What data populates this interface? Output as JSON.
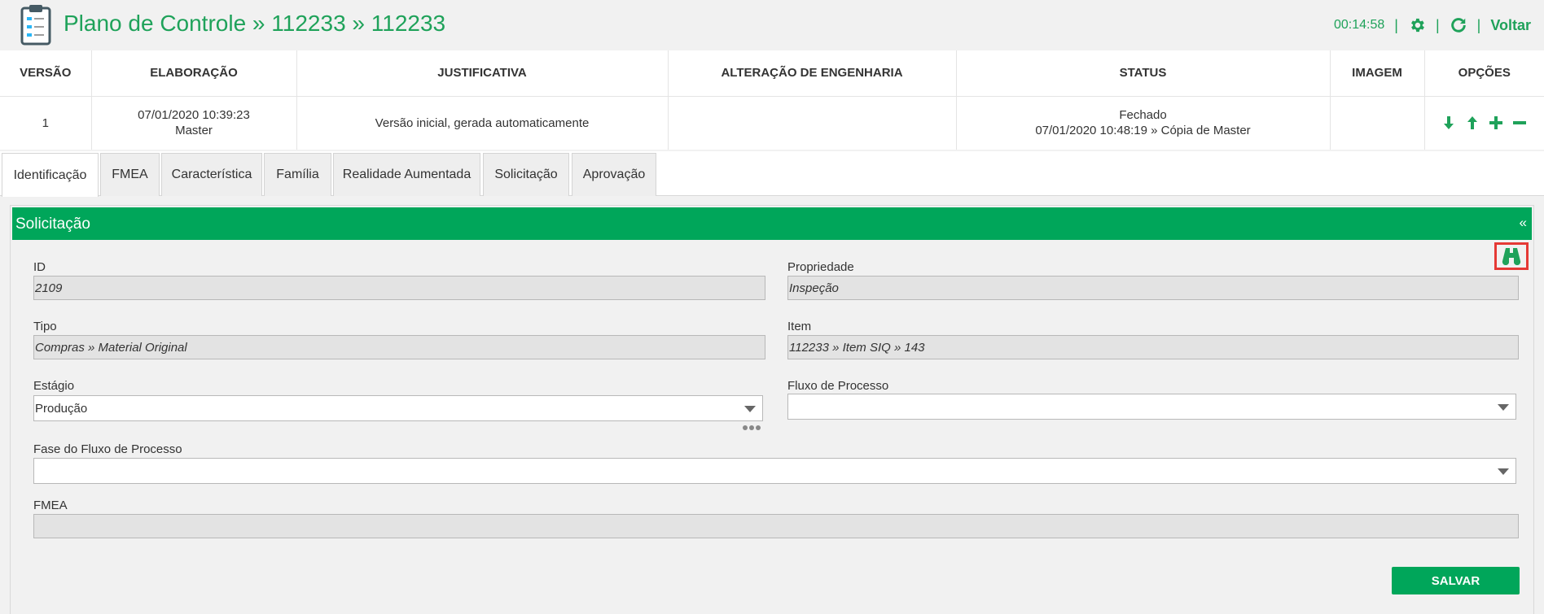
{
  "header": {
    "title": "Plano de Controle » 112233 » 112233",
    "timer": "00:14:58",
    "separator": "|",
    "back_label": "Voltar",
    "icons": [
      "clipboard-icon",
      "gear-icon",
      "refresh-icon"
    ]
  },
  "version_table": {
    "columns": [
      "VERSÃO",
      "ELABORAÇÃO",
      "JUSTIFICATIVA",
      "ALTERAÇÃO DE ENGENHARIA",
      "STATUS",
      "IMAGEM",
      "OPÇÕES"
    ],
    "row": {
      "versao": "1",
      "elaboracao_date": "07/01/2020 10:39:23",
      "elaboracao_user": "Master",
      "justificativa": "Versão inicial, gerada automaticamente",
      "alteracao": "",
      "status": "Fechado",
      "status_detail": "07/01/2020 10:48:19 » Cópia de Master",
      "imagem": "",
      "option_icons": [
        "arrow-down-icon",
        "arrow-up-icon",
        "plus-icon",
        "minus-icon"
      ]
    }
  },
  "tabs": [
    {
      "label": "Identificação",
      "active": true
    },
    {
      "label": "FMEA"
    },
    {
      "label": "Característica"
    },
    {
      "label": "Família"
    },
    {
      "label": "Realidade Aumentada"
    },
    {
      "label": "Solicitação"
    },
    {
      "label": "Aprovação"
    }
  ],
  "panel": {
    "title": "Solicitação",
    "collapse_symbol": "«",
    "fields": {
      "id": {
        "label": "ID",
        "value": "2109"
      },
      "propriedade": {
        "label": "Propriedade",
        "value": "Inspeção"
      },
      "tipo": {
        "label": "Tipo",
        "value": "Compras » Material Original"
      },
      "item": {
        "label": "Item",
        "value": "112233 » Item SIQ » 143"
      },
      "estagio": {
        "label": "Estágio",
        "value": "Produção"
      },
      "fluxo": {
        "label": "Fluxo de Processo",
        "value": ""
      },
      "fase": {
        "label": "Fase do Fluxo de Processo",
        "value": ""
      },
      "fmea": {
        "label": "FMEA",
        "value": ""
      }
    },
    "save_label": "SALVAR"
  },
  "colors": {
    "brand_green": "#1fa25a",
    "panel_green": "#00a65a",
    "highlight_red": "#e53935"
  }
}
